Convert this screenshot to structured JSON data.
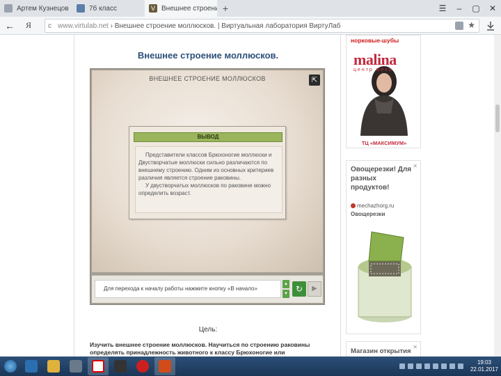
{
  "browser": {
    "tabs": [
      {
        "label": "Артем Кузнецов",
        "active": false
      },
      {
        "label": "7б класс",
        "active": false
      },
      {
        "label": "Внешнее строение моллюсков",
        "active": true
      }
    ],
    "new_tab": "+",
    "window_controls": [
      "☰",
      "–",
      "▢",
      "✕"
    ],
    "back": "←",
    "ya_button": "Я",
    "url_domain": "www.virtulab.net",
    "url_title": "› Внешнее строение моллюсков. | Виртуальная лаборатория ВиртуЛаб",
    "star": "★"
  },
  "page": {
    "title": "Внешнее строение моллюсков.",
    "lab": {
      "screen_title": "ВНЕШНЕЕ СТРОЕНИЕ МОЛЛЮСКОВ",
      "dialog_head": "ВЫВОД",
      "dialog_p1": "Представители классов Брюхоногие моллюски и Двустворчатые моллюски сильно различаются по внешнему строению. Одним из основных критериев различия является строение раковины.",
      "dialog_p2": "У двустворчатых моллюсков по раковине можно определить возраст.",
      "hint": "Для перехода к началу работы нажмите кнопку «В начало»",
      "arrow_up": "▲",
      "arrow_down": "▼",
      "restart": "↻",
      "next": "▶"
    },
    "goal_label": "Цель:",
    "goal_text": "Изучить внешнее строение моллюсков. Научиться по строению раковины определять принадлежность животного к классу Брюхоногие или Двустворчатые моллюски. Научиться"
  },
  "ads": {
    "ad1_top": "норковые-шубы",
    "ad1_logo": "malina",
    "ad1_logo_sub": "центр меха",
    "ad1_caption": "ТЦ «МАКСИМУМ»",
    "ad2_title": "Овощерезки! Для разных продуктов!",
    "ad2_site": "mechazhorg.ru",
    "ad2_name": "Овощерезки",
    "ad3_title": "Магазин открытия",
    "close": "✕"
  },
  "taskbar": {
    "clock_time": "19:03",
    "clock_date": "22.01.2017"
  },
  "colors": {
    "title_blue": "#2d4f79",
    "dialog_green": "#9ab55c",
    "taskbar": "#1b3657"
  }
}
